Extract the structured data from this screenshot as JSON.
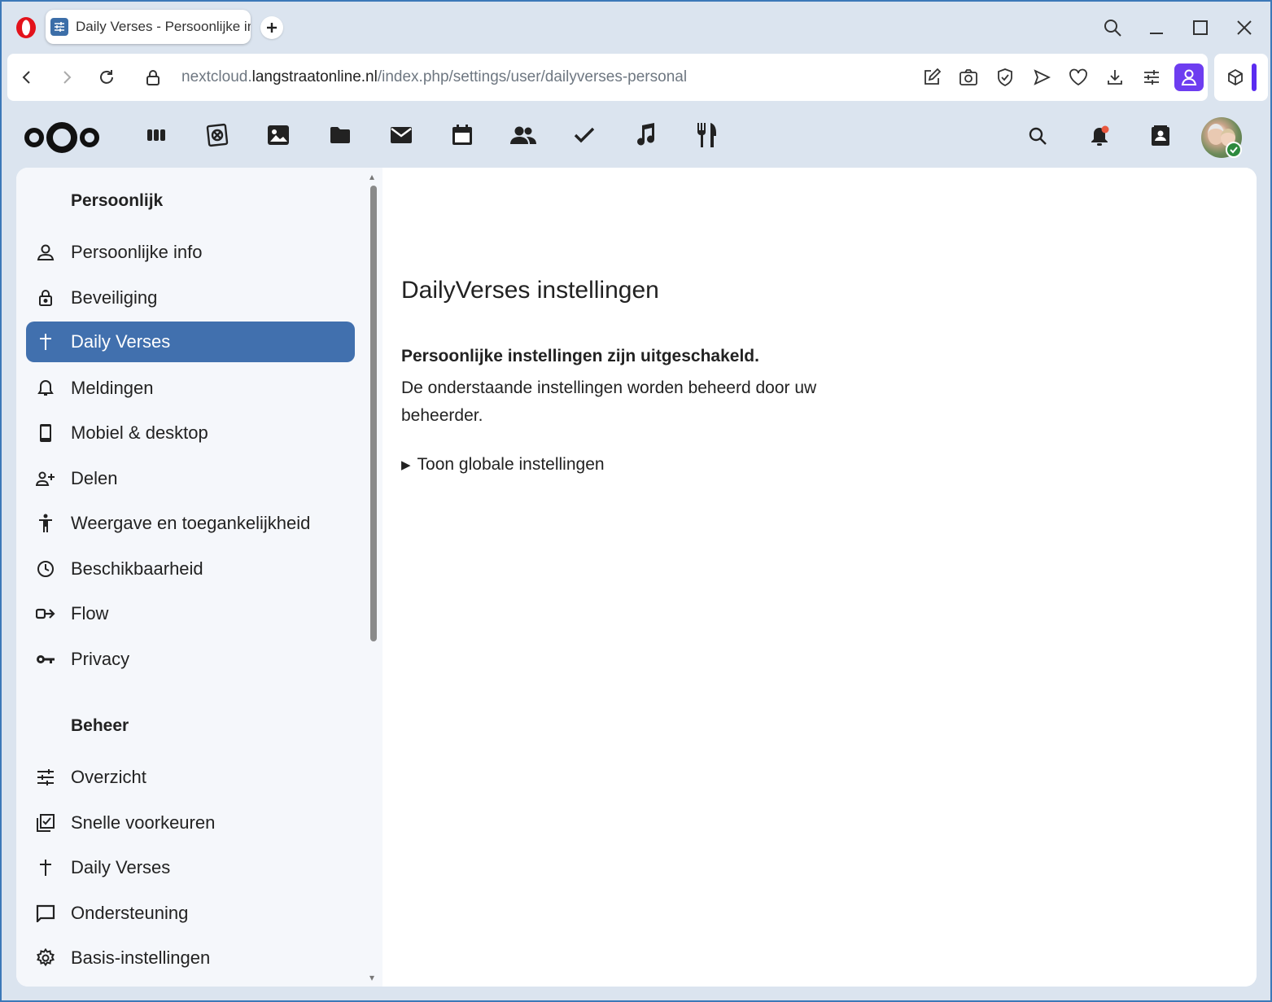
{
  "browser": {
    "tab_title": "Daily Verses - Persoonlijke instellingen",
    "url_prefix": "nextcloud.",
    "url_domain": "langstraatonline.nl",
    "url_path": "/index.php/settings/user/dailyverses-personal",
    "accent_color": "#6d3df0"
  },
  "header": {
    "apps": [
      "dashboard-icon",
      "photo-album-icon",
      "image-icon",
      "folder-icon",
      "mail-icon",
      "calendar-icon",
      "contacts-icon",
      "tasks-icon",
      "music-icon",
      "cookbook-icon"
    ]
  },
  "sidebar": {
    "personal_title": "Persoonlijk",
    "personal_items": [
      {
        "label": "Persoonlijke info"
      },
      {
        "label": "Beveiliging"
      },
      {
        "label": "Daily Verses"
      },
      {
        "label": "Meldingen"
      },
      {
        "label": "Mobiel & desktop"
      },
      {
        "label": "Delen"
      },
      {
        "label": "Weergave en toegankelijkheid"
      },
      {
        "label": "Beschikbaarheid"
      },
      {
        "label": "Flow"
      },
      {
        "label": "Privacy"
      }
    ],
    "admin_title": "Beheer",
    "admin_items": [
      {
        "label": "Overzicht"
      },
      {
        "label": "Snelle voorkeuren"
      },
      {
        "label": "Daily Verses"
      },
      {
        "label": "Ondersteuning"
      },
      {
        "label": "Basis-instellingen"
      }
    ],
    "active_color": "#4170ae"
  },
  "main": {
    "title": "DailyVerses instellingen",
    "notice_bold": "Persoonlijke instellingen zijn uitgeschakeld.",
    "notice_text": "De onderstaande instellingen worden beheerd door uw beheerder.",
    "toggle_label": "Toon globale instellingen"
  }
}
